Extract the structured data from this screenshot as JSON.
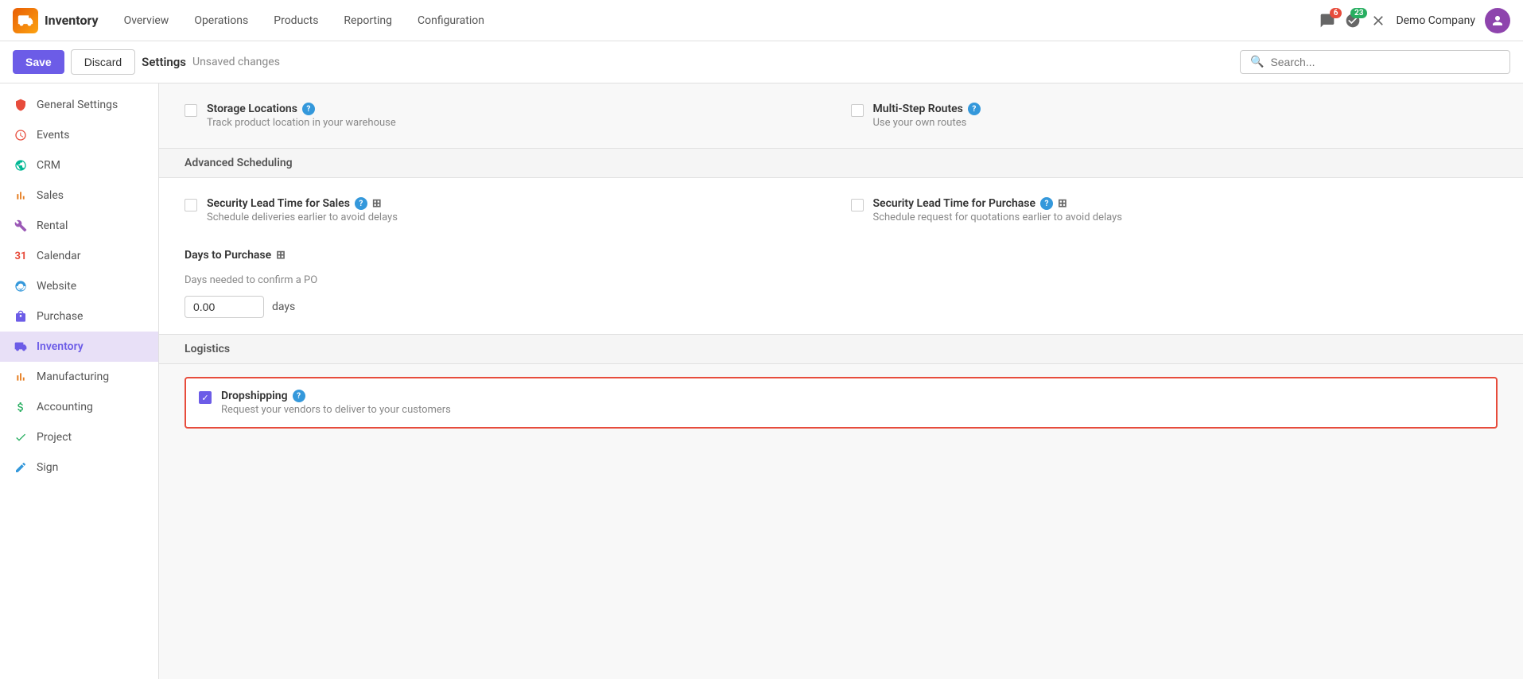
{
  "app": {
    "name": "Inventory",
    "logo_char": "📦"
  },
  "nav": {
    "items": [
      {
        "label": "Overview",
        "id": "overview"
      },
      {
        "label": "Operations",
        "id": "operations"
      },
      {
        "label": "Products",
        "id": "products"
      },
      {
        "label": "Reporting",
        "id": "reporting"
      },
      {
        "label": "Configuration",
        "id": "configuration"
      }
    ]
  },
  "header_icons": {
    "messages_badge": "6",
    "activity_badge": "23",
    "company": "Demo Company"
  },
  "toolbar": {
    "save_label": "Save",
    "discard_label": "Discard",
    "title": "Settings",
    "unsaved": "Unsaved changes",
    "search_placeholder": "Search..."
  },
  "sidebar": {
    "items": [
      {
        "label": "General Settings",
        "id": "general-settings",
        "icon": "⚙️",
        "color": "icon-general"
      },
      {
        "label": "Events",
        "id": "events",
        "icon": "✂️",
        "color": "icon-events"
      },
      {
        "label": "CRM",
        "id": "crm",
        "icon": "💧",
        "color": "icon-crm"
      },
      {
        "label": "Sales",
        "id": "sales",
        "icon": "📊",
        "color": "icon-sales"
      },
      {
        "label": "Rental",
        "id": "rental",
        "icon": "🔧",
        "color": "icon-rental"
      },
      {
        "label": "Calendar",
        "id": "calendar",
        "icon": "31",
        "color": "icon-calendar"
      },
      {
        "label": "Website",
        "id": "website",
        "icon": "🌐",
        "color": "icon-website"
      },
      {
        "label": "Purchase",
        "id": "purchase",
        "icon": "🛒",
        "color": "icon-purchase"
      },
      {
        "label": "Inventory",
        "id": "inventory",
        "icon": "📦",
        "color": "icon-inventory",
        "active": true
      },
      {
        "label": "Manufacturing",
        "id": "manufacturing",
        "icon": "📊",
        "color": "icon-manufacturing"
      },
      {
        "label": "Accounting",
        "id": "accounting",
        "icon": "📈",
        "color": "icon-accounting"
      },
      {
        "label": "Project",
        "id": "project",
        "icon": "✓",
        "color": "icon-project"
      },
      {
        "label": "Sign",
        "id": "sign",
        "icon": "✍️",
        "color": "icon-sign"
      }
    ]
  },
  "content": {
    "warehouse_section": {
      "storage_locations": {
        "title": "Storage Locations",
        "desc": "Track product location in your warehouse",
        "checked": false
      },
      "multi_step_routes": {
        "title": "Multi-Step Routes",
        "desc": "Use your own routes",
        "checked": false
      }
    },
    "advanced_scheduling": {
      "header": "Advanced Scheduling",
      "security_lead_sales": {
        "title": "Security Lead Time for Sales",
        "desc": "Schedule deliveries earlier to avoid delays",
        "checked": false
      },
      "security_lead_purchase": {
        "title": "Security Lead Time for Purchase",
        "desc": "Schedule request for quotations earlier to avoid delays",
        "checked": false
      },
      "days_to_purchase": {
        "title": "Days to Purchase",
        "desc": "Days needed to confirm a PO",
        "value": "0.00",
        "unit": "days"
      }
    },
    "logistics": {
      "header": "Logistics",
      "dropshipping": {
        "title": "Dropshipping",
        "desc": "Request your vendors to deliver to your customers",
        "checked": true
      }
    }
  }
}
